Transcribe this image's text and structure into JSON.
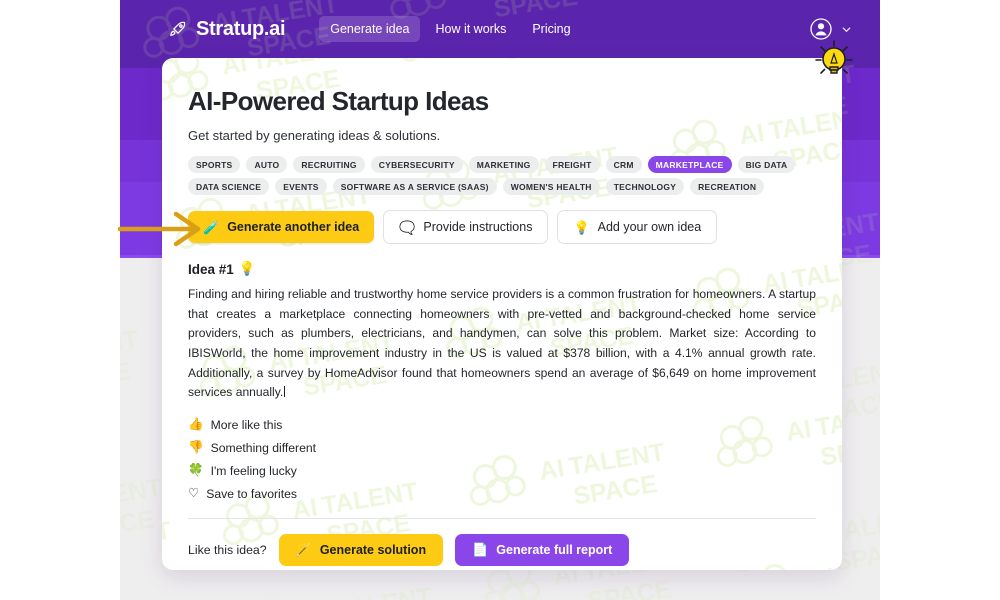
{
  "brand": {
    "name": "Stratup.ai",
    "logo_icon": "rocket-icon"
  },
  "nav": {
    "links": [
      {
        "label": "Generate idea",
        "active": true
      },
      {
        "label": "How it works",
        "active": false
      },
      {
        "label": "Pricing",
        "active": false
      }
    ],
    "account_icon": "user-avatar-icon",
    "chevron_icon": "chevron-down-icon"
  },
  "hero": {
    "title": "AI-Powered Startup Ideas",
    "subtitle": "Get started by generating ideas & solutions."
  },
  "tags": [
    {
      "label": "SPORTS",
      "active": false
    },
    {
      "label": "AUTO",
      "active": false
    },
    {
      "label": "RECRUITING",
      "active": false
    },
    {
      "label": "CYBERSECURITY",
      "active": false
    },
    {
      "label": "MARKETING",
      "active": false
    },
    {
      "label": "FREIGHT",
      "active": false
    },
    {
      "label": "CRM",
      "active": false
    },
    {
      "label": "MARKETPLACE",
      "active": true
    },
    {
      "label": "BIG DATA",
      "active": false
    },
    {
      "label": "DATA SCIENCE",
      "active": false
    },
    {
      "label": "EVENTS",
      "active": false
    },
    {
      "label": "SOFTWARE AS A SERVICE (SAAS)",
      "active": false
    },
    {
      "label": "WOMEN'S HEALTH",
      "active": false
    },
    {
      "label": "TECHNOLOGY",
      "active": false
    },
    {
      "label": "RECREATION",
      "active": false
    }
  ],
  "actions": {
    "generate_another": {
      "label": "Generate another idea",
      "emoji": "🧪",
      "icon_name": "flask-icon"
    },
    "provide_instructions": {
      "label": "Provide instructions",
      "emoji": "🗨️",
      "icon_name": "speech-balloon-icon"
    },
    "add_own_idea": {
      "label": "Add your own idea",
      "emoji": "💡",
      "icon_name": "lightbulb-icon"
    }
  },
  "idea": {
    "heading": "Idea #1",
    "heading_emoji": "💡",
    "body": "Finding and hiring reliable and trustworthy home service providers is a common frustration for homeowners. A startup that creates a marketplace connecting homeowners with pre-vetted and background-checked home service providers, such as plumbers, electricians, and handymen, can solve this problem. Market size: According to IBISWorld, the home improvement industry in the US is valued at $378 billion, with a 4.1% annual growth rate. Additionally, a survey by HomeAdvisor found that homeowners spend an average of $6,649 on home improvement services annually."
  },
  "feedback": [
    {
      "label": "More like this",
      "emoji": "👍",
      "icon_name": "thumbs-up-icon"
    },
    {
      "label": "Something different",
      "emoji": "👎",
      "icon_name": "thumbs-down-icon"
    },
    {
      "label": "I'm feeling lucky",
      "emoji": "🍀",
      "icon_name": "four-leaf-clover-icon"
    },
    {
      "label": "Save to favorites",
      "emoji": "♡",
      "icon_name": "heart-outline-icon"
    }
  ],
  "footer": {
    "label": "Like this idea?",
    "generate_solution": {
      "label": "Generate solution",
      "emoji": "🪄",
      "icon_name": "magic-wand-icon"
    },
    "generate_report": {
      "label": "Generate full report",
      "emoji": "📄",
      "icon_name": "document-icon"
    }
  },
  "decoration": {
    "bulb_icon": "lightbulb-icon",
    "arrow_icon": "arrow-right-annotation-icon"
  },
  "watermark": {
    "text": "AI TALENT SPACE"
  },
  "colors": {
    "purple_dark": "#5b24ad",
    "purple_mid": "#6d29c9",
    "purple_light": "#7d3ae2",
    "accent_purple": "#8b46ea",
    "accent_yellow": "#fdcb13",
    "arrow_orange": "#d9a017",
    "page_gray": "#efeeef"
  }
}
